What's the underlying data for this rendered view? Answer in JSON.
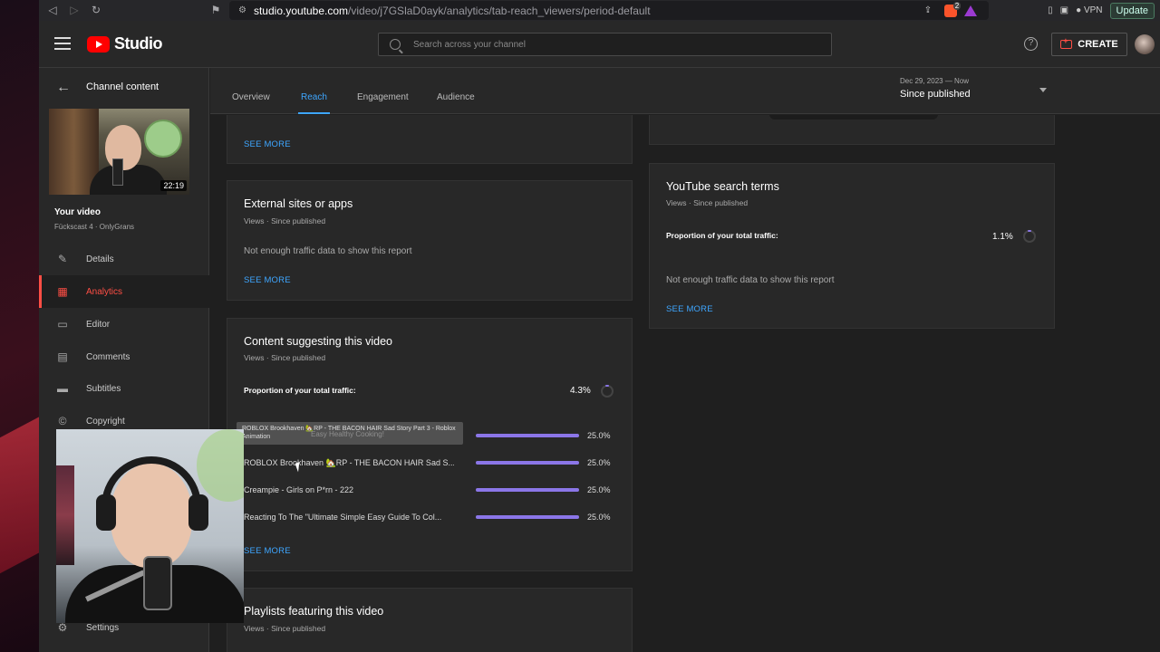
{
  "browser": {
    "url_host": "studio.youtube.com",
    "url_path": "/video/j7GSlaD0ayk/analytics/tab-reach_viewers/period-default",
    "brave_badge": "2",
    "vpn_label": "VPN",
    "update_label": "Update"
  },
  "topbar": {
    "logo_text": "Studio",
    "search_placeholder": "Search across your channel",
    "help_label": "?",
    "create_label": "CREATE"
  },
  "sidebar": {
    "back_label": "Channel content",
    "thumbnail_duration": "22:19",
    "your_video_label": "Your video",
    "video_name": "Fückscast 4 · OnlyGrans",
    "items": [
      {
        "label": "Details",
        "icon": "pencil-icon",
        "glyph": "✎",
        "active": false
      },
      {
        "label": "Analytics",
        "icon": "analytics-icon",
        "glyph": "▦",
        "active": true
      },
      {
        "label": "Editor",
        "icon": "film-icon",
        "glyph": "▭",
        "active": false
      },
      {
        "label": "Comments",
        "icon": "comment-icon",
        "glyph": "▤",
        "active": false
      },
      {
        "label": "Subtitles",
        "icon": "subtitles-icon",
        "glyph": "▬",
        "active": false
      },
      {
        "label": "Copyright",
        "icon": "copyright-icon",
        "glyph": "©",
        "active": false
      }
    ],
    "settings_label": "Settings"
  },
  "tabs": {
    "items": [
      "Overview",
      "Reach",
      "Engagement",
      "Audience"
    ],
    "active": "Reach"
  },
  "period": {
    "range": "Dec 29, 2023 — Now",
    "label": "Since published"
  },
  "cards": {
    "top_left": {
      "see_more": "SEE MORE"
    },
    "external": {
      "title": "External sites or apps",
      "subtitle": "Views · Since published",
      "note": "Not enough traffic data to show this report",
      "see_more": "SEE MORE"
    },
    "suggesting": {
      "title": "Content suggesting this video",
      "subtitle": "Views · Since published",
      "proportion_label": "Proportion of your total traffic:",
      "proportion_value": "4.3%",
      "proportion_fraction": 0.043,
      "tooltip": "ROBLOX Brookhaven 🏡RP - THE BACON HAIR Sad Story Part 3 - Roblox Animation",
      "tooltip_ghost": "Easy Healthy Cooking!",
      "rows": [
        {
          "title": "",
          "pct": "25.0%",
          "fraction": 1.0
        },
        {
          "title": "ROBLOX Brookhaven 🏡RP - THE BACON HAIR Sad S...",
          "pct": "25.0%",
          "fraction": 1.0
        },
        {
          "title": "Creampie - Girls on P*rn - 222",
          "pct": "25.0%",
          "fraction": 1.0
        },
        {
          "title": "Reacting To The \"Ultimate Simple Easy Guide To Col...",
          "pct": "25.0%",
          "fraction": 1.0
        }
      ],
      "see_more": "SEE MORE"
    },
    "playlists": {
      "title": "Playlists featuring this video",
      "subtitle": "Views · Since published"
    },
    "search_terms": {
      "title": "YouTube search terms",
      "subtitle": "Views · Since published",
      "proportion_label": "Proportion of your total traffic:",
      "proportion_value": "1.1%",
      "proportion_fraction": 0.011,
      "note": "Not enough traffic data to show this report",
      "see_more": "SEE MORE"
    }
  },
  "colors": {
    "accent_blue": "#3ea6ff",
    "active_red": "#ff4e45",
    "bar_purple": "#8b76e8",
    "brand_red": "#ff0000"
  }
}
